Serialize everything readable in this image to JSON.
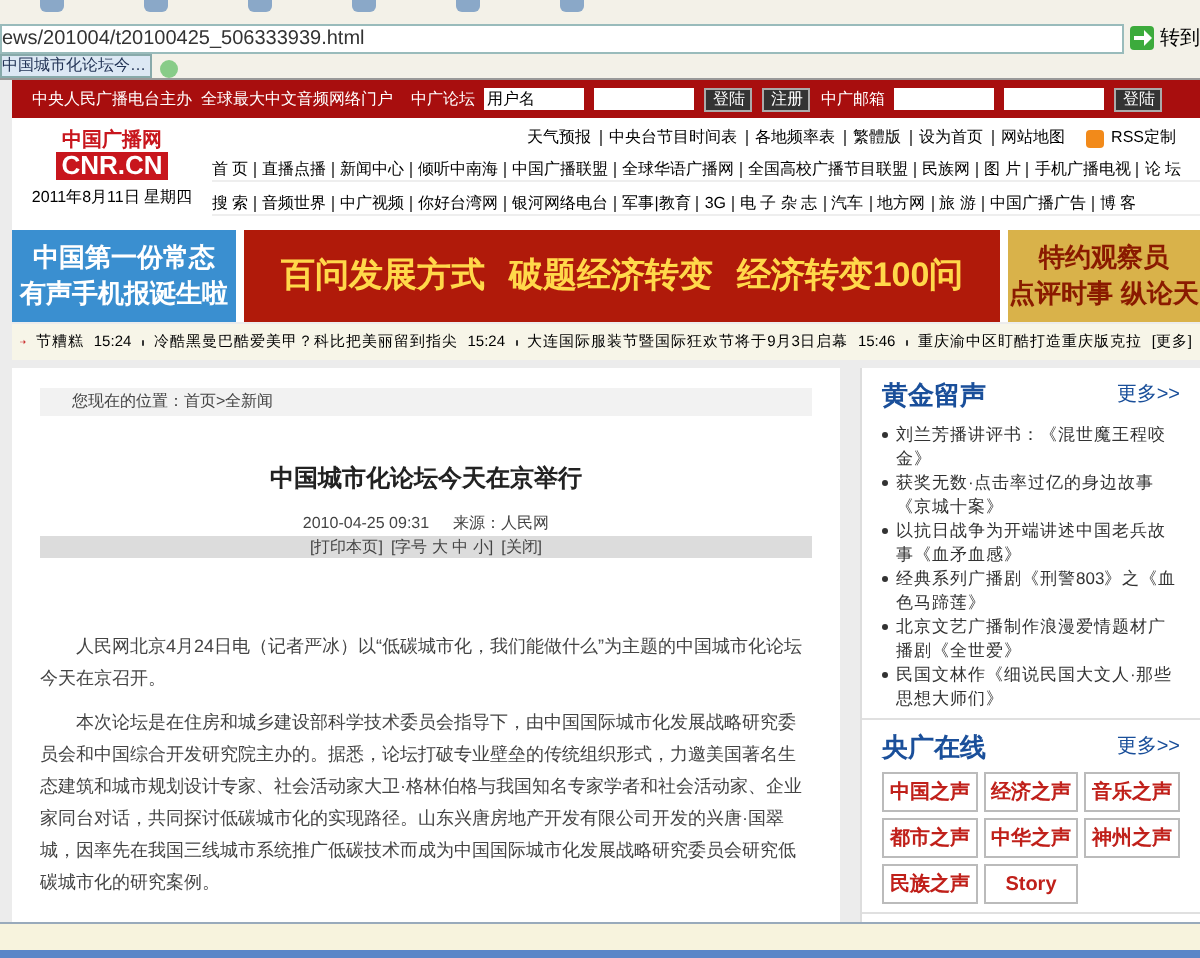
{
  "browser": {
    "url": "ews/201004/t20100425_506333939.html",
    "go_label": "转到",
    "tab_title": "中国城市化论坛今…"
  },
  "top_bar": {
    "slogan": "中央人民广播电台主办  全球最大中文音频网络门户",
    "forum_label": "中广论坛",
    "username_placeholder": "用户名",
    "login": "登陆",
    "register": "注册",
    "mail_label": "中广邮箱",
    "mail_login": "登陆"
  },
  "header": {
    "logo_cn": "中国广播网",
    "logo_en": "CNR.CN",
    "date": "2011年8月11日 星期四",
    "util_links": [
      "天气预报",
      "中央台节目时间表",
      "各地频率表",
      "繁體版",
      "设为首页",
      "网站地图"
    ],
    "rss": "RSS定制",
    "nav_rows": [
      [
        "首 页",
        "直播点播",
        "新闻中心",
        "倾听中南海",
        "中国广播联盟",
        "全球华语广播网",
        "全国高校广播节目联盟",
        "民族网",
        "图 片",
        "手机广播电视",
        "论 坛"
      ],
      [
        "搜 索",
        "音频世界",
        "中广视频",
        "你好台湾网",
        "银河网络电台",
        "军事|教育",
        "3G",
        "电 子 杂 志",
        "汽车",
        "地方网",
        "旅 游",
        "中国广播广告",
        "博 客"
      ]
    ]
  },
  "banners": [
    {
      "kind": "phone",
      "lines": [
        "中国第一份常态",
        "有声手机报诞生啦"
      ]
    },
    {
      "kind": "economy",
      "lines": [
        "百问发展方式",
        "破题经济转变",
        "经济转变100问"
      ]
    },
    {
      "kind": "observer",
      "lines": [
        "特约观察员",
        "点评时事 纵论天"
      ]
    }
  ],
  "ticker": {
    "items": [
      {
        "text": "节糟糕",
        "time": "15:24"
      },
      {
        "text": "冷酷黑曼巴酷爱美甲？科比把美丽留到指尖",
        "time": "15:24"
      },
      {
        "text": "大连国际服装节暨国际狂欢节将于9月3日启幕",
        "time": "15:46"
      },
      {
        "text": "重庆渝中区盯酷打造重庆版克拉"
      }
    ],
    "more": "[更多]"
  },
  "article": {
    "breadcrumb": "您现在的位置：首页>全新闻",
    "title": "中国城市化论坛今天在京举行",
    "date": "2010-04-25 09:31",
    "source": "来源：人民网",
    "tools": [
      "[打印本页]",
      "[字号 大 中 小]",
      "[关闭]"
    ],
    "paragraphs": [
      "人民网北京4月24日电（记者严冰）以“低碳城市化，我们能做什么”为主题的中国城市化论坛今天在京召开。",
      "本次论坛是在住房和城乡建设部科学技术委员会指导下，由中国国际城市化发展战略研究委员会和中国综合开发研究院主办的。据悉，论坛打破专业壁垒的传统组织形式，力邀美国著名生态建筑和城市规划设计专家、社会活动家大卫·格林伯格与我国知名专家学者和社会活动家、企业家同台对话，共同探讨低碳城市化的实现路径。山东兴唐房地产开发有限公司开发的兴唐·国翠城，因率先在我国三线城市系统推广低碳技术而成为中国国际城市化发展战略研究委员会研究低碳城市化的研究案例。"
    ]
  },
  "sidebar": {
    "sections": [
      {
        "kind": "list",
        "title": "黄金留声",
        "more": "更多>>",
        "items": [
          "刘兰芳播讲评书：《混世魔王程咬金》",
          "获奖无数·点击率过亿的身边故事《京城十案》",
          "以抗日战争为开端讲述中国老兵故事《血矛血感》",
          "经典系列广播剧《刑警803》之《血色马蹄莲》",
          "北京文艺广播制作浪漫爱情题材广播剧《全世爱》",
          "民国文林作《细说民国大文人·那些思想大师们》"
        ]
      },
      {
        "kind": "logos",
        "title": "央广在线",
        "more": "更多>>",
        "items": [
          "中国之声",
          "经济之声",
          "音乐之声",
          "都市之声",
          "中华之声",
          "神州之声",
          "民族之声",
          "Story"
        ]
      }
    ]
  }
}
